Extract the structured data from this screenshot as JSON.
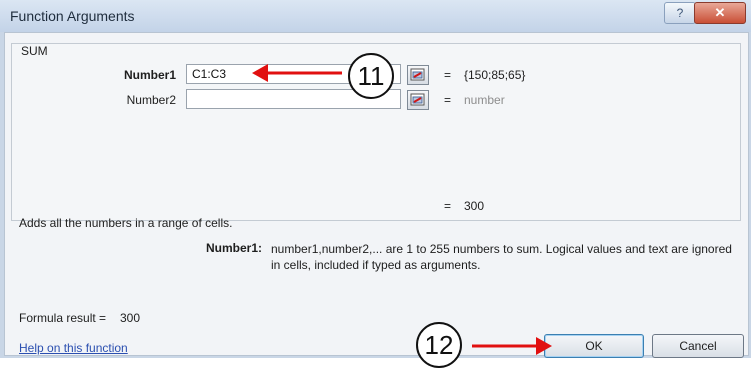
{
  "window": {
    "title": "Function Arguments",
    "help_glyph": "?",
    "close_glyph": "✕"
  },
  "function": {
    "name": "SUM",
    "args": [
      {
        "label": "Number1",
        "value": "C1:C3",
        "equals": "=",
        "result": "{150;85;65}",
        "bold": true
      },
      {
        "label": "Number2",
        "value": "",
        "equals": "=",
        "result": "number",
        "bold": false
      }
    ],
    "total_equals": "=",
    "total_result": "300",
    "description": "Adds all the numbers in a range of cells.",
    "arg_desc_label": "Number1:",
    "arg_desc_text": "number1,number2,... are 1 to 255 numbers to sum. Logical values and text are ignored in cells, included if typed as arguments."
  },
  "footer": {
    "formula_result_label": "Formula result =",
    "formula_result_value": "300",
    "help_link": "Help on this function",
    "ok_label": "OK",
    "cancel_label": "Cancel"
  },
  "annotations": {
    "step_a": "11",
    "step_b": "12",
    "arrow_color": "#e11010"
  },
  "icons": {
    "collapse": "range-collapse-icon",
    "arrow": "arrow-left-icon"
  }
}
